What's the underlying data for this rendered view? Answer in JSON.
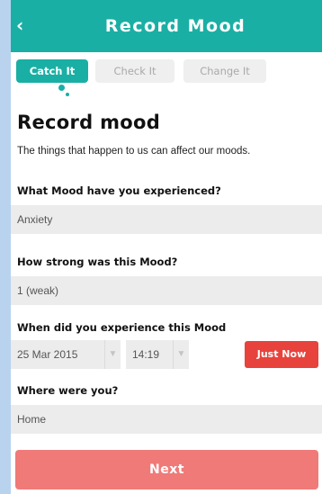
{
  "header": {
    "title": "Record Mood",
    "back_icon": "chevron-left-icon"
  },
  "tabs": [
    {
      "label": "Catch It",
      "active": true
    },
    {
      "label": "Check It",
      "active": false
    },
    {
      "label": "Change It",
      "active": false
    }
  ],
  "main": {
    "heading": "Record mood",
    "intro": "The things that happen to us can affect our moods.",
    "mood": {
      "label": "What Mood have you experienced?",
      "value": "Anxiety"
    },
    "strength": {
      "label": "How strong was this Mood?",
      "value": "1 (weak)"
    },
    "when": {
      "label": "When did you experience this Mood",
      "date": "25 Mar 2015",
      "time": "14:19",
      "just_now": "Just Now"
    },
    "where": {
      "label": "Where were you?",
      "value": "Home"
    },
    "next": "Next"
  },
  "colors": {
    "accent": "#1aafa4",
    "danger": "#e8423c",
    "next": "#f07a78",
    "frame": "#b9d3ee"
  }
}
